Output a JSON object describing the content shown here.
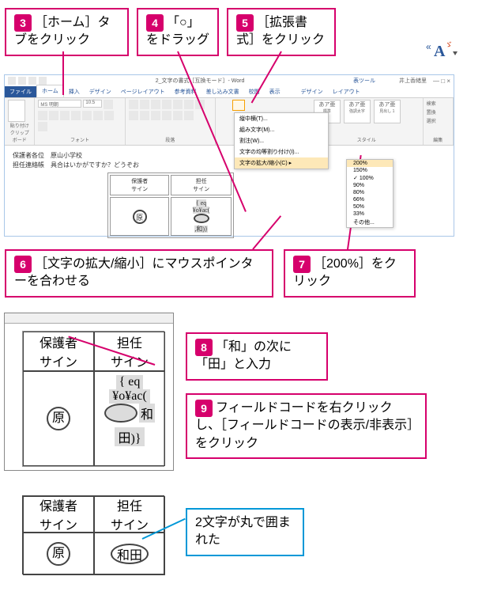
{
  "callouts": {
    "c3": "［ホーム］タブをクリック",
    "c4": "「○」をドラッグ",
    "c5": "［拡張書式］をクリック",
    "c6": "［文字の拡大/縮小］にマウスポインターを合わせる",
    "c7": "［200%］をクリック",
    "c8": "「和」の次に「田」と入力",
    "c9": "フィールドコードを右クリックし、［フィールドコードの表示/非表示］をクリック",
    "result": "2文字が丸で囲まれた"
  },
  "nums": {
    "n3": "3",
    "n4": "4",
    "n5": "5",
    "n6": "6",
    "n7": "7",
    "n8": "8",
    "n9": "9"
  },
  "word": {
    "title": "2_文字の書式［互換モード］- Word",
    "tool": "表ツール",
    "user": "井上香緒里",
    "tabs": {
      "file": "ファイル",
      "home": "ホーム",
      "insert": "挿入",
      "design": "デザイン",
      "layout": "ページレイアウト",
      "ref": "参考資料",
      "mail": "差し込み文書",
      "review": "校閲",
      "view": "表示",
      "tdesign": "デザイン",
      "tlayout": "レイアウト"
    },
    "ribbon": {
      "clipboard": "クリップボード",
      "font": "フォント",
      "para": "段落",
      "style": "スタイル",
      "edit": "編集",
      "paste": "貼り付け",
      "st1": "あア亜",
      "st2": "あア亜",
      "st3": "あア亜",
      "stlabel1": "標準",
      "stlabel2": "強調太字",
      "stlabel3": "見出し 1",
      "find": "検索",
      "replace": "置換",
      "select": "選択"
    },
    "dropdown": {
      "tate": "縦中横(T)...",
      "kumi": "組み文字(M)...",
      "warichu": "割注(W)...",
      "kinto": "文字の均等割り付け(I)...",
      "scale": "文字の拡大/縮小(C)"
    },
    "pct": {
      "p200": "200%",
      "p150": "150%",
      "p100": "100%",
      "p90": "90%",
      "p80": "80%",
      "p66": "66%",
      "p50": "50%",
      "p33": "33%",
      "other": "その他..."
    },
    "doc": {
      "l1": "保護者各位",
      "l2": "原山小学校",
      "l3": "担任連絡帳",
      "l4": "具合はいかがですか？どうぞお"
    }
  },
  "table": {
    "h1": "保護者",
    "h2": "担任",
    "sign": "サイン",
    "code_eq": "{ eq",
    "code_ac": "¥o¥ac(",
    "code_wa": ",和)}",
    "code_wada": "和田",
    "stamp_hara": "原",
    "stamp_wada": "和田",
    "ta": "田)}",
    "wa": "和"
  }
}
